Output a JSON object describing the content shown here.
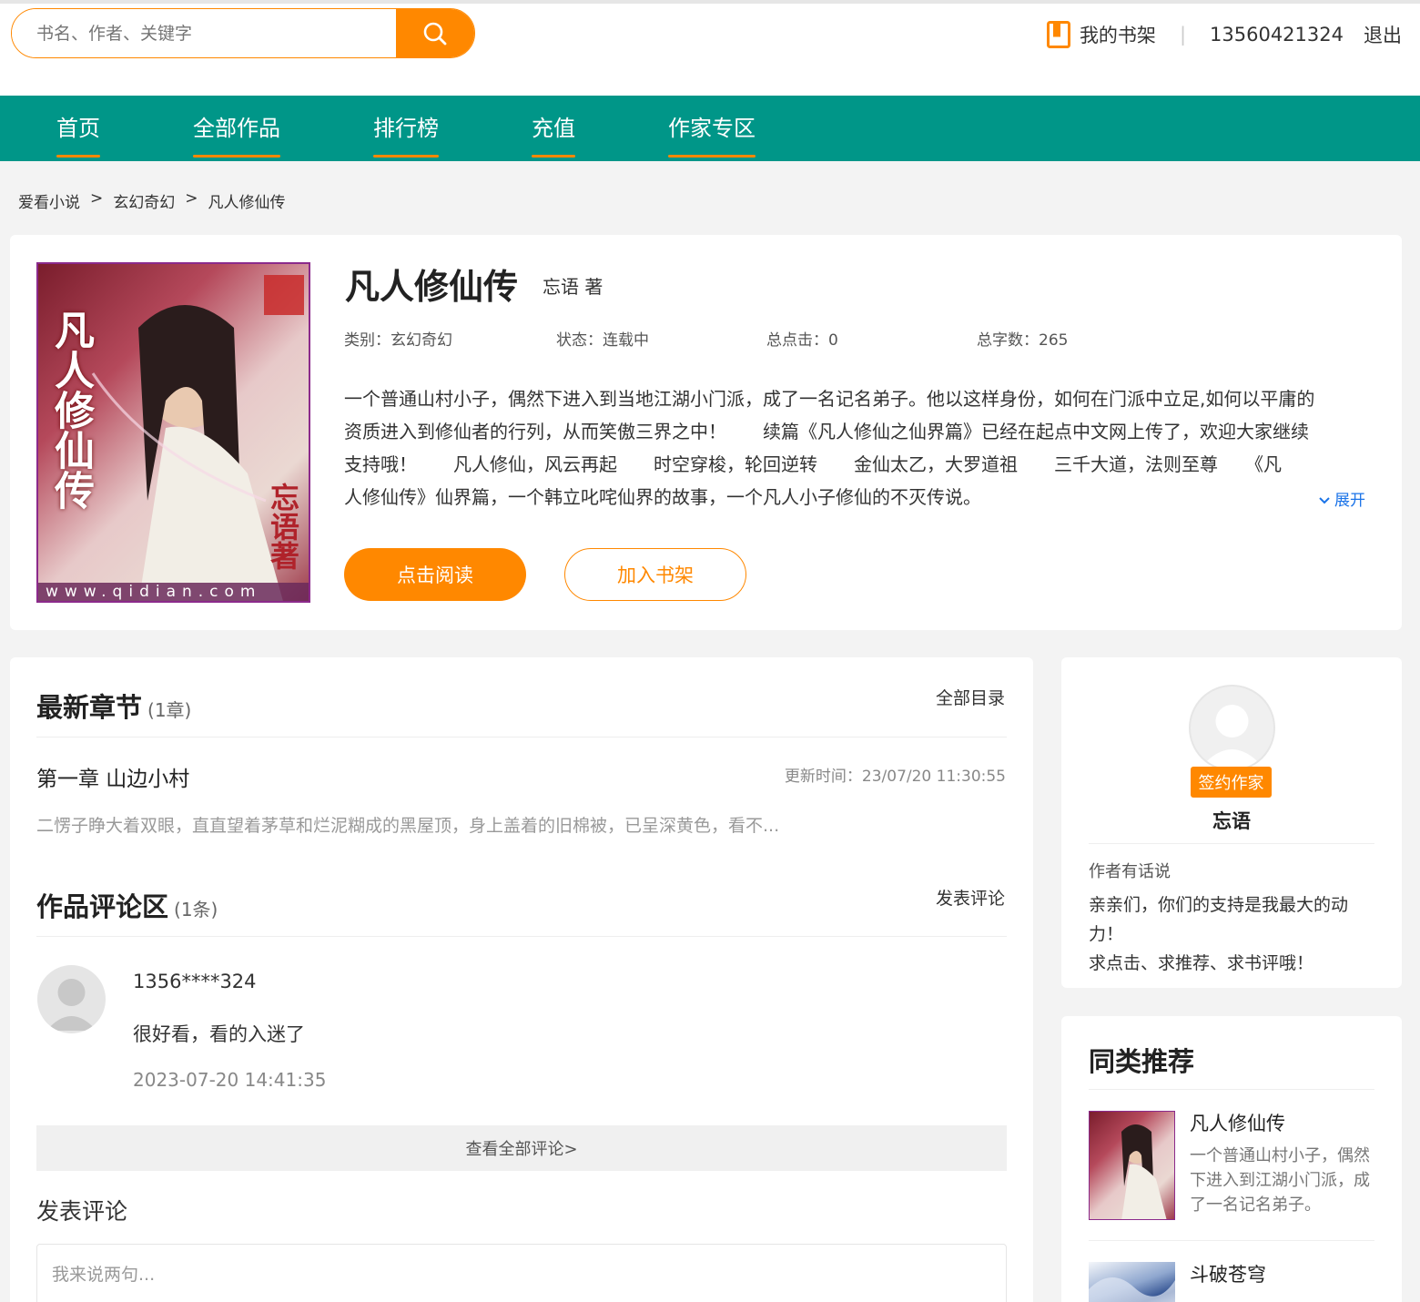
{
  "header": {
    "search_placeholder": "书名、作者、关键字",
    "shelf_label": "我的书架",
    "separator": "|",
    "phone": "13560421324",
    "logout_label": "退出"
  },
  "nav": {
    "items": [
      "首页",
      "全部作品",
      "排行榜",
      "充值",
      "作家专区"
    ]
  },
  "breadcrumb": {
    "items": [
      "爱看小说",
      "玄幻奇幻",
      "凡人修仙传"
    ],
    "sep": ">"
  },
  "book": {
    "title": "凡人修仙传",
    "author": "忘语 著",
    "category": "类别：玄幻奇幻",
    "status": "状态：连载中",
    "clicks": "总点击：0",
    "words": "总字数：265",
    "intro_lines": [
      "一个普通山村小子，偶然下进入到当地江湖小门派，成了一名记名弟子。他以这样身份，如何在门派中立足,如何以平庸的",
      "资质进入到修仙者的行列，从而笑傲三界之中！　　续篇《凡人修仙之仙界篇》已经在起点中文网上传了，欢迎大家继续",
      "支持哦！　　凡人修仙，风云再起　　时空穿梭，轮回逆转　　金仙太乙，大罗道祖　　三千大道，法则至尊　　《凡",
      "人修仙传》仙界篇，一个韩立叱咤仙界的故事，一个凡人小子修仙的不灭传说。"
    ],
    "expand_label": "展开",
    "read_button": "点击阅读",
    "shelf_button": "加入书架",
    "cover_text": "凡人修仙传",
    "cover_author": "忘语著",
    "cover_url": "www.qidian.com"
  },
  "latest": {
    "title": "最新章节",
    "count": "(1章)",
    "all_link": "全部目录",
    "chapter": "第一章 山边小村",
    "update_time": "更新时间：23/07/20 11:30:55",
    "excerpt": "二愣子睁大着双眼，直直望着茅草和烂泥糊成的黑屋顶，身上盖着的旧棉被，已呈深黄色，看不..."
  },
  "comments": {
    "title": "作品评论区",
    "count": "(1条)",
    "post_link": "发表评论",
    "items": [
      {
        "user": "1356****324",
        "text": "很好看，看的入迷了",
        "time": "2023-07-20 14:41:35"
      }
    ],
    "view_all": "查看全部评论>",
    "post_title": "发表评论",
    "input_placeholder": "我来说两句..."
  },
  "author_card": {
    "badge": "签约作家",
    "name": "忘语",
    "say_title": "作者有话说",
    "say_lines": [
      "亲亲们，你们的支持是我最大的动力！",
      "求点击、求推荐、求书评哦！"
    ]
  },
  "recommend": {
    "title": "同类推荐",
    "items": [
      {
        "name": "凡人修仙传",
        "desc": "一个普通山村小子，偶然下进入到江湖小门派，成了一名记名弟子。"
      },
      {
        "name": "斗破苍穹",
        "desc": ""
      }
    ]
  },
  "colors": {
    "accent": "#ff8800",
    "nav_bg": "#009688",
    "link_blue": "#1a73e8"
  }
}
